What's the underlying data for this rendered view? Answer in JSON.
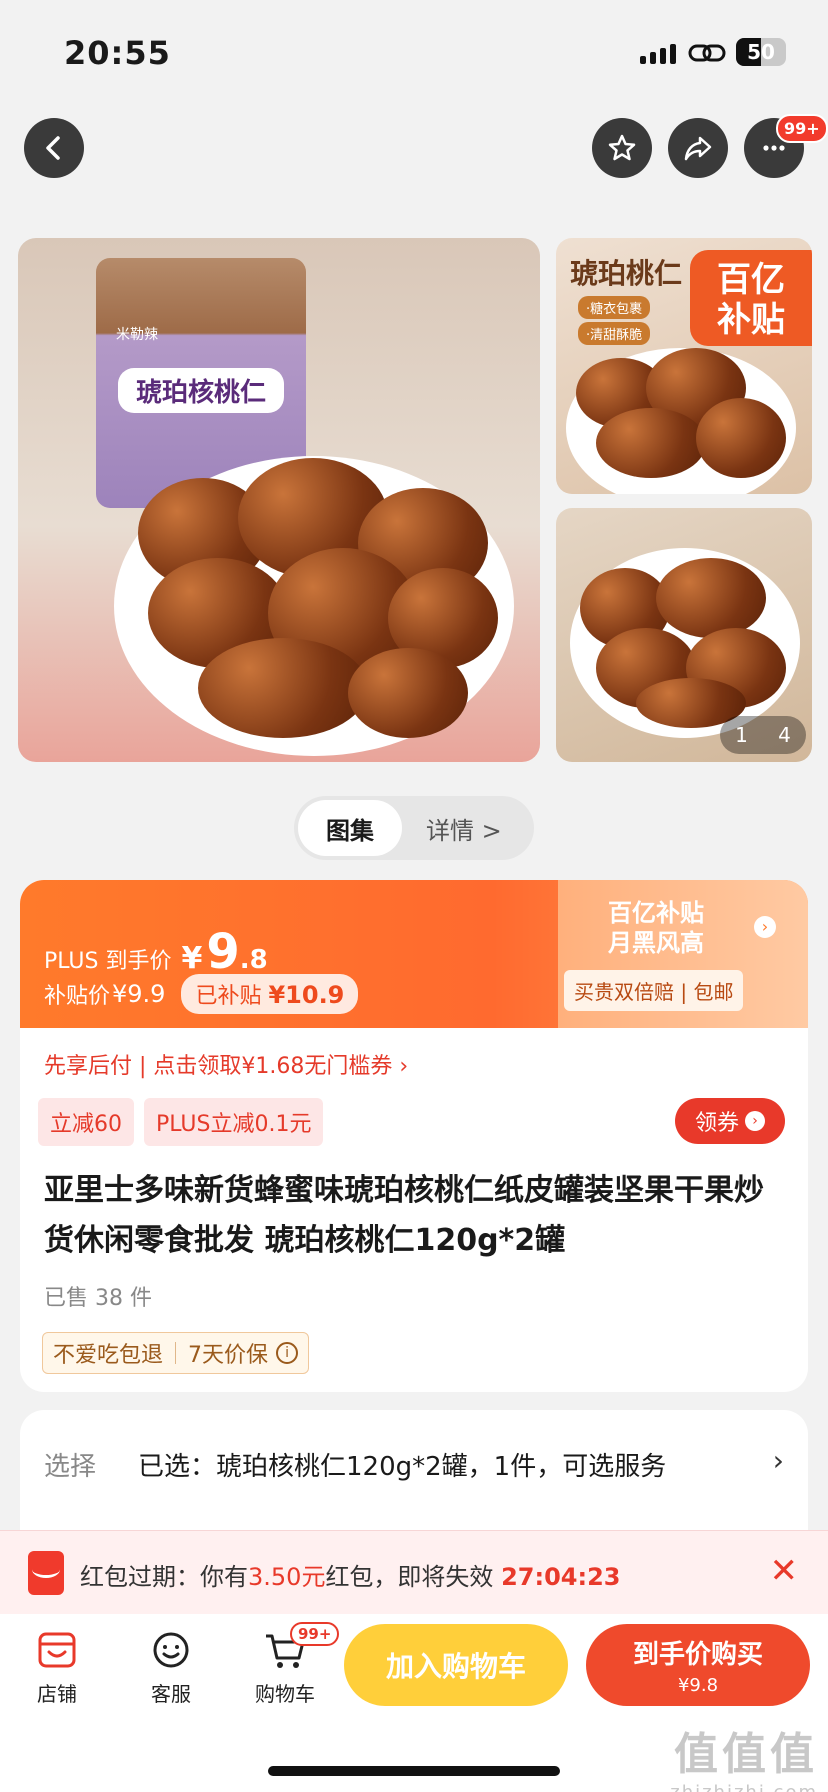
{
  "status_bar": {
    "time": "20:55",
    "battery": "50",
    "battery_level": 0.5
  },
  "nav": {
    "badge": "99+",
    "back_icon": "back-icon",
    "favorite_icon": "star-icon",
    "share_icon": "share-icon",
    "more_icon": "more-icon"
  },
  "gallery": {
    "jar_brand": "米勒辣",
    "jar_label": "琥珀核桃仁",
    "side_title": "琥珀桃仁",
    "side_tags": [
      "·糖衣包裹",
      "·清甜酥脆"
    ],
    "subsidy_badge": [
      "百亿",
      "补贴"
    ],
    "counter_current": "1",
    "counter_total": "4"
  },
  "view_toggle": {
    "active": "图集",
    "other": "详情 >"
  },
  "price": {
    "plus_label": "PLUS 到手价",
    "yen": "¥",
    "integer": "9",
    "decimal": ".8",
    "subsidy_label": "补贴价",
    "subsidy_price": "¥9.9",
    "subsidized_label": "已补贴",
    "subsidized_amount": "¥10.9",
    "slogan_1": "百亿补贴",
    "slogan_2": "月黑风高",
    "guarantee": "买贵双倍赔 | 包邮"
  },
  "promo": {
    "pay_later": "先享后付 | 点击领取¥1.68无门槛券 ›",
    "tag_1": "立减60",
    "tag_2": "PLUS立减0.1元",
    "coupon_button": "领券"
  },
  "product": {
    "title": "亚里士多味新货蜂蜜味琥珀核桃仁纸皮罐装坚果干果炒货休闲零食批发 琥珀核桃仁120g*2罐",
    "sold": "已售 38 件",
    "service_1": "不爱吃包退",
    "service_2": "7天价保"
  },
  "selection": {
    "label": "选择",
    "value": "已选：琥珀核桃仁120g*2罐，1件，可选服务",
    "chevron": "›"
  },
  "red_packet": {
    "prefix": "红包过期：你有",
    "amount": "3.50元",
    "suffix": "红包，即将失效",
    "countdown": "27:04:23"
  },
  "bottom_bar": {
    "shop": "店铺",
    "service": "客服",
    "cart": "购物车",
    "cart_badge": "99+",
    "add_to_cart": "加入购物车",
    "buy_now": "到手价购买",
    "buy_now_price": "¥9.8"
  },
  "watermark": {
    "line1": "值值值",
    "line2": "zhizhizhi.com"
  }
}
